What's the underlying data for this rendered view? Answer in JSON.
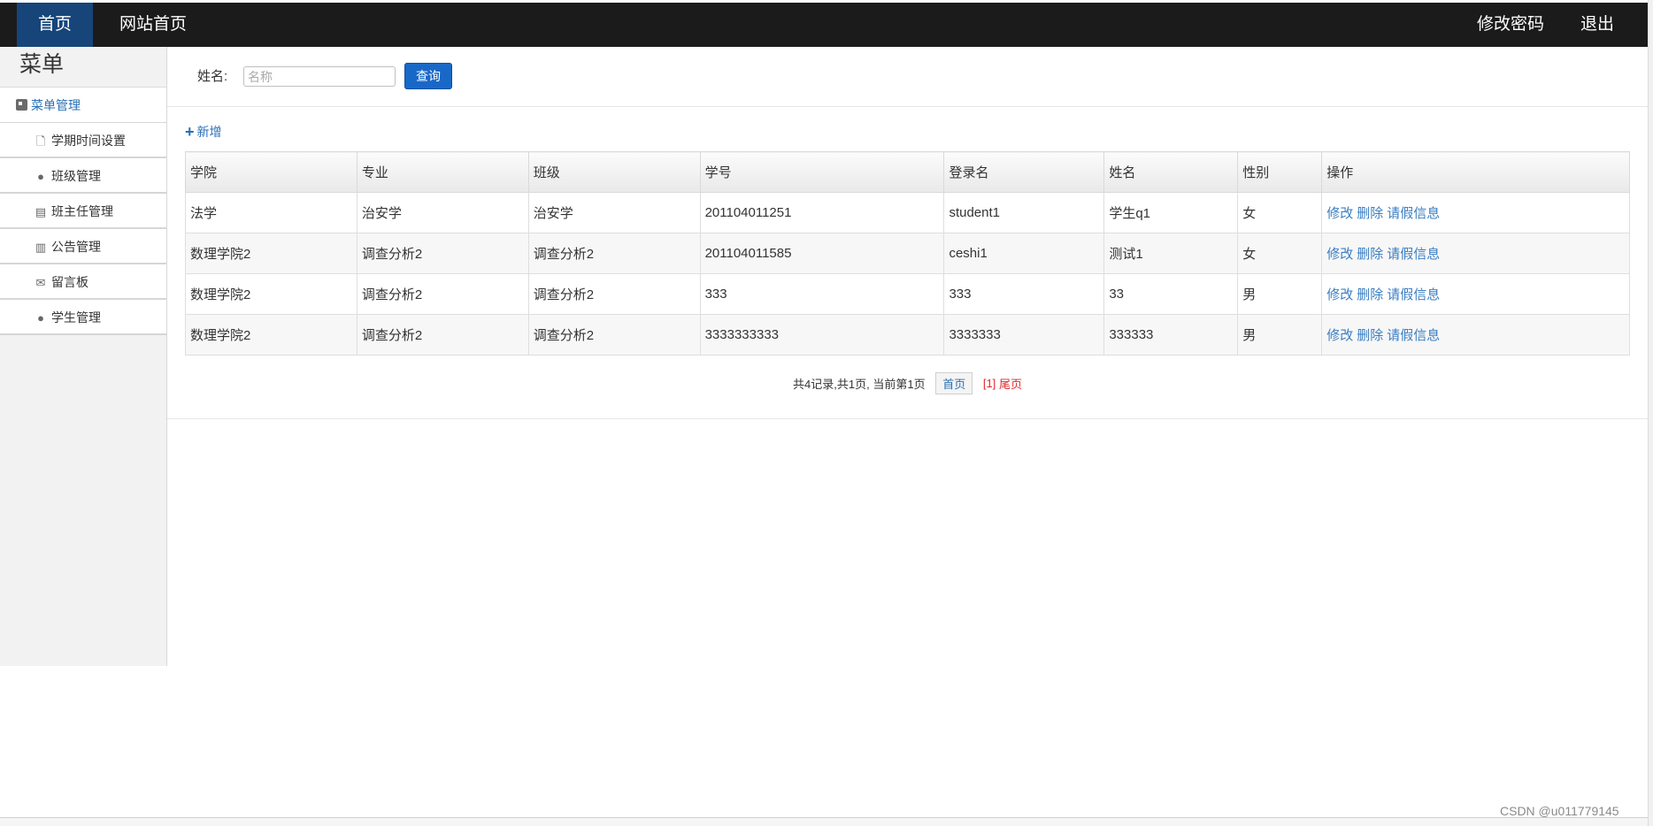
{
  "topbar": {
    "home": "首页",
    "site_home": "网站首页",
    "change_password": "修改密码",
    "logout": "退出"
  },
  "sidebar": {
    "title": "菜单",
    "group": "菜单管理",
    "items": [
      {
        "label": "学期时间设置",
        "icon": "file-icon"
      },
      {
        "label": "班级管理",
        "icon": "comment-icon"
      },
      {
        "label": "班主任管理",
        "icon": "list-icon"
      },
      {
        "label": "公告管理",
        "icon": "books-icon"
      },
      {
        "label": "留言板",
        "icon": "envelope-icon"
      },
      {
        "label": "学生管理",
        "icon": "comment-icon"
      }
    ]
  },
  "search": {
    "label": "姓名:",
    "placeholder": "名称",
    "value": "",
    "button": "查询"
  },
  "toolbar": {
    "add_label": "新增"
  },
  "table": {
    "headers": [
      "学院",
      "专业",
      "班级",
      "学号",
      "登录名",
      "姓名",
      "性别",
      "操作"
    ],
    "rows": [
      [
        "法学",
        "治安学",
        "治安学",
        "201104011251",
        "student1",
        "学生q1",
        "女"
      ],
      [
        "数理学院2",
        "调查分析2",
        "调查分析2",
        "201104011585",
        "ceshi1",
        "测试1",
        "女"
      ],
      [
        "数理学院2",
        "调查分析2",
        "调查分析2",
        "333",
        "333",
        "33",
        "男"
      ],
      [
        "数理学院2",
        "调查分析2",
        "调查分析2",
        "3333333333",
        "3333333",
        "333333",
        "男"
      ]
    ],
    "actions": [
      "修改",
      "删除",
      "请假信息"
    ]
  },
  "pager": {
    "info": "共4记录,共1页, 当前第1页",
    "first": "首页",
    "current": "[1]",
    "last": "尾页"
  },
  "watermark": "CSDN @u011779145",
  "colors": {
    "topbar_bg": "#1b1b1b",
    "nav_active_bg": "#17457a",
    "link": "#3a7ec3",
    "primary_button": "#1868c8",
    "pager_current": "#e0262b"
  }
}
